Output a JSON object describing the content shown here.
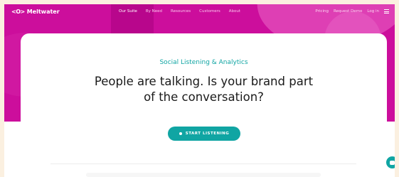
{
  "nav": {
    "logo_mark": "<O>",
    "logo_text": "Meltwater",
    "links": [
      "Our Suite",
      "By Need",
      "Resources",
      "Customers",
      "About"
    ],
    "right_links": [
      "Pricing",
      "Request Demo",
      "Log in"
    ]
  },
  "hero": {
    "eyebrow": "Social Listening & Analytics",
    "headline_line1": "People are talking. Is your brand part",
    "headline_line2": "of the conversation?",
    "cta_label": "START LISTENING"
  },
  "colors": {
    "brand_magenta": "#cc0e9c",
    "accent_teal": "#10a5a3"
  }
}
